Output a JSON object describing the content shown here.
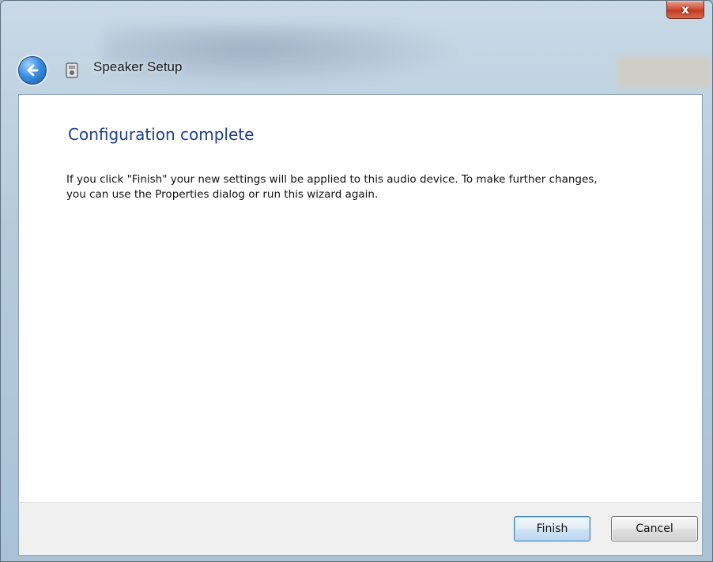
{
  "window": {
    "title": "Speaker Setup",
    "close_glyph": "x"
  },
  "icons": {
    "back": "back-arrow-icon",
    "app": "speaker-setup-icon",
    "close": "close-icon"
  },
  "content": {
    "heading": "Configuration complete",
    "body": "If you click \"Finish\" your new settings will be applied to this audio device.  To make further changes, you can use the Properties dialog or run this wizard again."
  },
  "footer": {
    "finish_label": "Finish",
    "cancel_label": "Cancel"
  },
  "colors": {
    "heading": "#1e3d8f",
    "close_button": "#c13a22",
    "back_button": "#3a8ee0"
  }
}
